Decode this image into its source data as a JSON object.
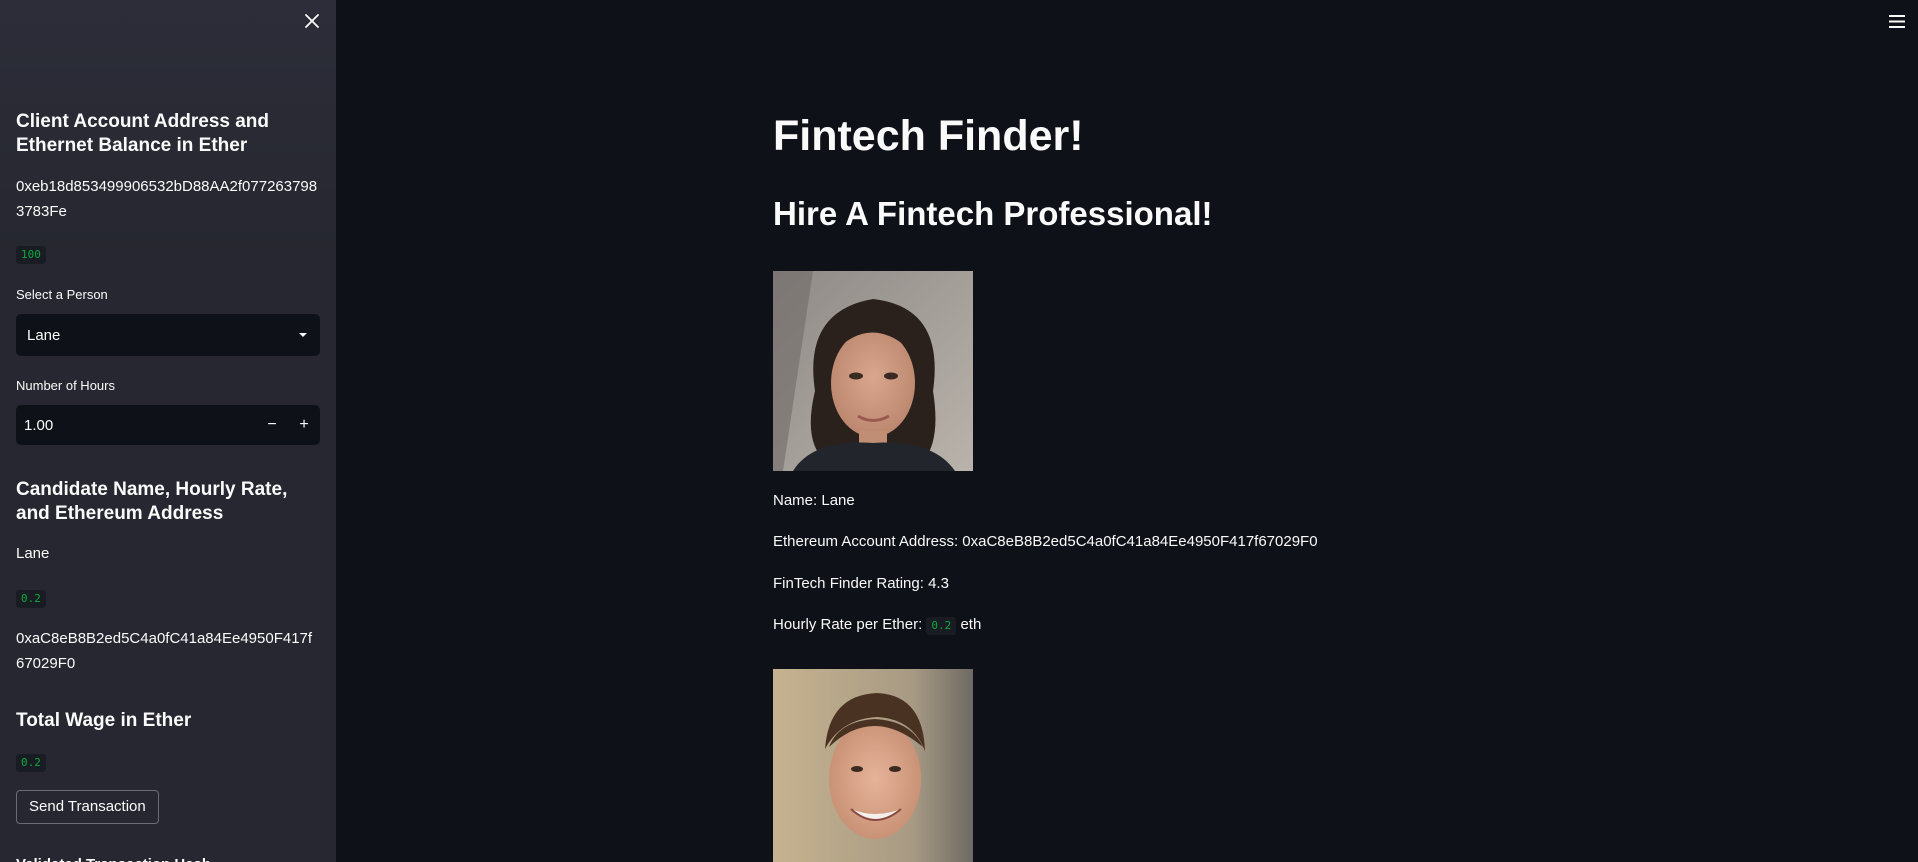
{
  "sidebar": {
    "client_heading": "Client Account Address and Ethernet Balance in Ether",
    "client_address": "0xeb18d853499906532bD88AA2f0772637983783Fe",
    "client_balance": "100",
    "select_label": "Select a Person",
    "select_value": "Lane",
    "hours_label": "Number of Hours",
    "hours_value": "1.00",
    "candidate_heading": "Candidate Name, Hourly Rate, and Ethereum Address",
    "candidate_name": "Lane",
    "candidate_rate": "0.2",
    "candidate_address": "0xaC8eB8B2ed5C4a0fC41a84Ee4950F417f67029F0",
    "wage_heading": "Total Wage in Ether",
    "wage_value": "0.2",
    "send_button": "Send Transaction",
    "validated_heading": "Validated Transaction Hash"
  },
  "main": {
    "title": "Fintech Finder!",
    "subtitle": "Hire A Fintech Professional!",
    "profile": {
      "name_line": "Name: Lane",
      "address_line": "Ethereum Account Address: 0xaC8eB8B2ed5C4a0fC41a84Ee4950F417f67029F0",
      "rating_line": "FinTech Finder Rating: 4.3",
      "rate_prefix": "Hourly Rate per Ether:",
      "rate_value": "0.2",
      "rate_suffix": "eth"
    }
  },
  "icons": {
    "close": "close-icon",
    "menu": "hamburger-menu-icon",
    "dropdown": "caret-down-icon"
  },
  "colors": {
    "background": "#0e1117",
    "sidebar": "#262730",
    "code_green": "#09ab3b"
  }
}
